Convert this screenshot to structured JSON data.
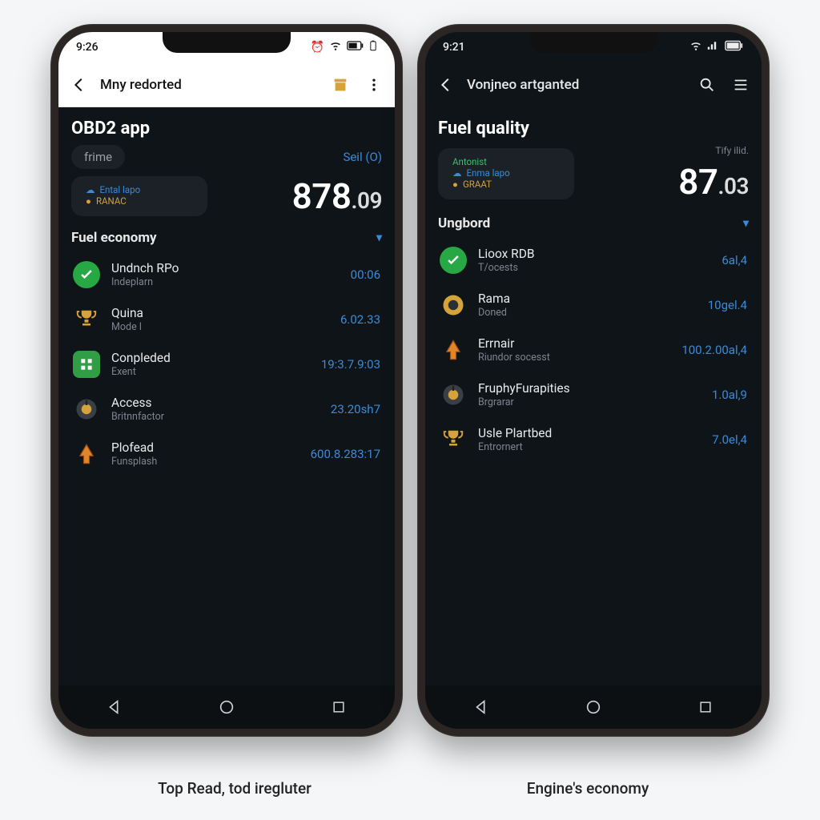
{
  "captions": {
    "left": "Top Read, tod iregluter",
    "right": "Engine's economy"
  },
  "left": {
    "status": {
      "time": "9:26"
    },
    "appbar": {
      "title": "Mny redorted"
    },
    "title": "OBD2 app",
    "pill": {
      "left": "frime",
      "right": "Seil (O)"
    },
    "hero": {
      "line1_label": "Ental lapo",
      "line2_label": "RANAC",
      "value_int": "878",
      "value_dec": ".09"
    },
    "section_title": "Fuel economy",
    "items": [
      {
        "icon": "check",
        "t1": "Undnch RPo",
        "t2": "Indeplarn",
        "val": "00:06"
      },
      {
        "icon": "trophy",
        "t1": "Quina",
        "t2": "Mode l",
        "val": "6.02.33"
      },
      {
        "icon": "grid",
        "t1": "Conpleded",
        "t2": "Exent",
        "val": "19:3.7.9:03"
      },
      {
        "icon": "dial",
        "t1": "Access",
        "t2": "Britnnfactor",
        "val": "23.20sh7"
      },
      {
        "icon": "arrow",
        "t1": "Plofead",
        "t2": "Funsplash",
        "val": "600.8.283:17"
      }
    ]
  },
  "right": {
    "status": {
      "time": "9:21"
    },
    "appbar": {
      "title": "Vonjneo artganted"
    },
    "title": "Fuel quality",
    "pill_right": "Tify ilid.",
    "hero": {
      "line0_label": "Antonist",
      "line1_label": "Enma lapo",
      "line2_label": "GRAAT",
      "value_int": "87",
      "value_dec": ".03"
    },
    "section_title": "Ungbord",
    "items": [
      {
        "icon": "check",
        "t1": "Lioox RDB",
        "t2": "T/ocests",
        "val": "6al,4"
      },
      {
        "icon": "ring",
        "t1": "Rama",
        "t2": "Doned",
        "val": "10gel.4"
      },
      {
        "icon": "arrow",
        "t1": "Errnair",
        "t2": "Riundor socesst",
        "val": "100.2.00al,4"
      },
      {
        "icon": "dial",
        "t1": "FruphyFurapities",
        "t2": "Brgrarar",
        "val": "1.0al,9"
      },
      {
        "icon": "trophy",
        "t1": "Usle Plartbed",
        "t2": "Entrornert",
        "val": "7.0el,4"
      }
    ]
  }
}
